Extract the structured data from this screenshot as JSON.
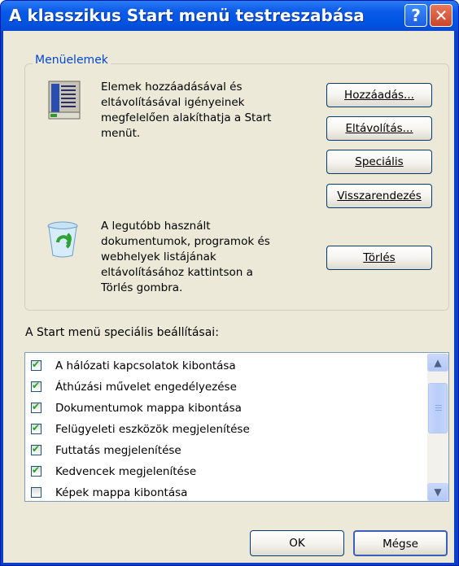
{
  "window": {
    "title": "A klasszikus Start menü testreszabása",
    "help_glyph": "?",
    "close_glyph": "✕"
  },
  "group": {
    "legend": "Menüelemek",
    "description1": [
      "Elemek hozzáadásával és",
      "eltávolításával igényeinek",
      "megfelelően alakíthatja a Start",
      "menüt."
    ],
    "description2": [
      "A legutóbb használt",
      "dokumentumok, programok és",
      "webhelyek listájának",
      "eltávolításához kattintson a",
      "Törlés gombra."
    ],
    "icon1": "start-menu-icon",
    "icon2": "recycle-bin-icon"
  },
  "buttons": {
    "add": "Hozzáadás...",
    "remove": "Eltávolítás...",
    "advanced": "Speciális",
    "sort": "Visszarendezés",
    "clear": "Törlés",
    "ok": "OK",
    "cancel": "Mégse"
  },
  "list": {
    "label": "A Start menü speciális beállításai:",
    "items": [
      {
        "label": "A hálózati kapcsolatok kibontása",
        "checked": true
      },
      {
        "label": "Áthúzási művelet engedélyezése",
        "checked": true
      },
      {
        "label": "Dokumentumok mappa kibontása",
        "checked": true
      },
      {
        "label": "Felügyeleti eszközök megjelenítése",
        "checked": true
      },
      {
        "label": "Futtatás megjelenítése",
        "checked": true
      },
      {
        "label": "Kedvencek megjelenítése",
        "checked": true
      },
      {
        "label": "Képek mappa kibontása",
        "checked": false
      }
    ],
    "scroll_up": "▲",
    "scroll_down": "▼"
  },
  "colors": {
    "titlebar": "#0054e3",
    "dialog_bg": "#ece9d8",
    "legend": "#0046d5",
    "check": "#21a121"
  }
}
